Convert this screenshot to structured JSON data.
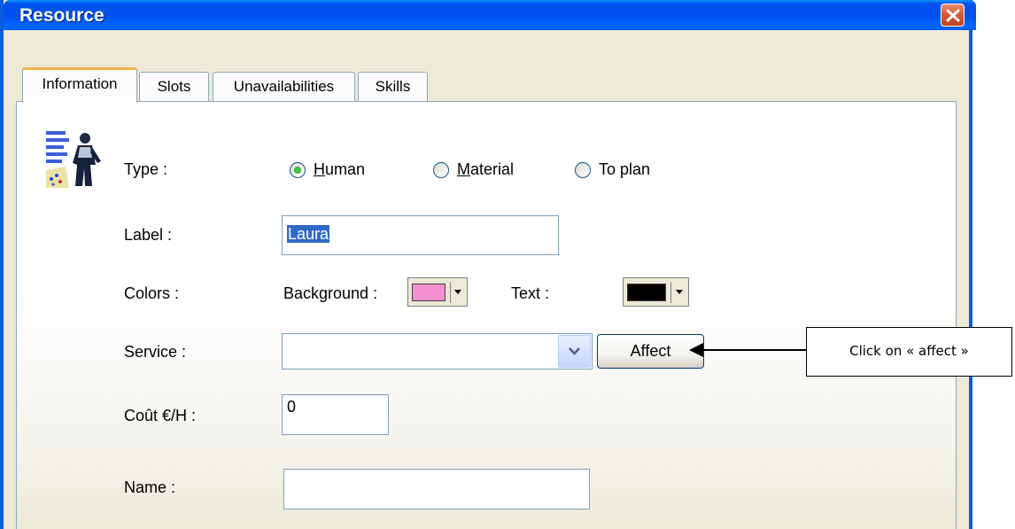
{
  "window": {
    "title": "Resource"
  },
  "tabs": [
    {
      "label": "Information",
      "active": true
    },
    {
      "label": "Slots",
      "active": false
    },
    {
      "label": "Unavailabilities",
      "active": false
    },
    {
      "label": "Skills",
      "active": false
    }
  ],
  "form": {
    "type": {
      "label": "Type :",
      "options": [
        {
          "label": "Human",
          "accel": "H",
          "rest": "uman",
          "selected": true
        },
        {
          "label": "Material",
          "accel": "M",
          "rest": "aterial",
          "selected": false
        },
        {
          "label": "To plan",
          "selected": false
        }
      ]
    },
    "label_field": {
      "label": "Label :",
      "value": "Laura"
    },
    "colors": {
      "label": "Colors :",
      "background_label": "Background :",
      "background_color": "#f58fcf",
      "text_label": "Text :",
      "text_color": "#000000"
    },
    "service": {
      "label": "Service :",
      "value": "",
      "affect_label": "Affect"
    },
    "cost": {
      "label": "Coût €/H :",
      "value": "0"
    },
    "name": {
      "label": "Name :",
      "value": ""
    }
  },
  "annotation": {
    "text": "Click on « affect »"
  },
  "icons": [
    "close-icon",
    "resource-person-icon",
    "dropdown-chevron-icon",
    "arrow-left-icon"
  ],
  "colors": {
    "titlebar": "#0053ee",
    "window_border": "#0a5be0",
    "close": "#d95a30",
    "active_tab_accent": "#f2b34a"
  }
}
